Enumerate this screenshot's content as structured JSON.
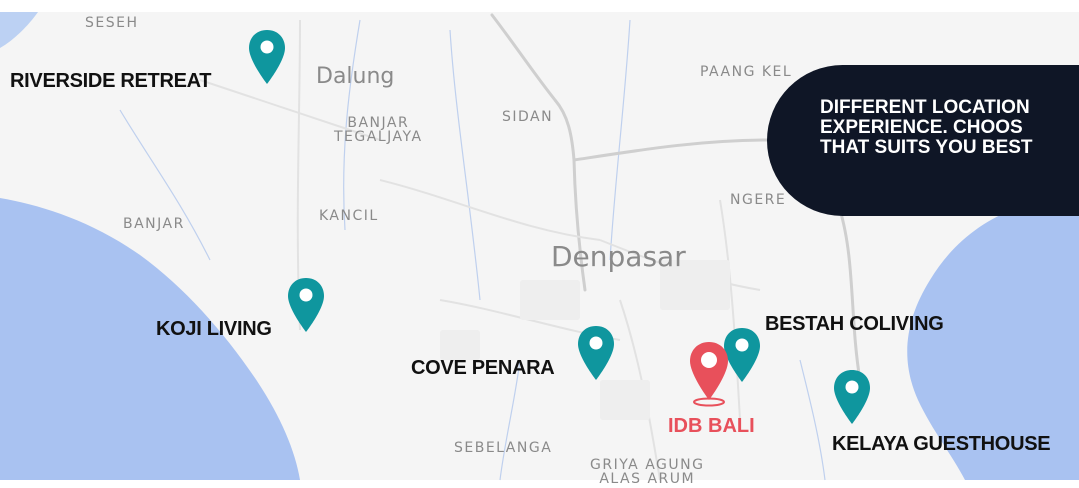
{
  "map": {
    "water_color": "#a9c2f1",
    "land_color": "#f6f6f6",
    "road_color": "#d3d3d3",
    "area_labels": {
      "seseh": "SESEH",
      "banjar_tegaljaya": "BANJAR\nTEGALJAYA",
      "sidan": "SIDAN",
      "paang_kelod": "PAANG KEL",
      "ngereh": "NGERE",
      "kancil": "KANCIL",
      "banjar": "BANJAR",
      "sebelanga": "SEBELANGA",
      "griya_agung": "GRIYA AGUNG\nALAS ARUM"
    },
    "city_labels": {
      "dalung": "Dalung",
      "denpasar": "Denpasar"
    }
  },
  "locations": {
    "riverside": {
      "label": "RIVERSIDE RETREAT",
      "icon": "map-pin-icon"
    },
    "koji": {
      "label": "KOJI LIVING",
      "icon": "map-pin-icon"
    },
    "cove": {
      "label": "COVE PENARA",
      "icon": "map-pin-icon"
    },
    "bestah": {
      "label": "BESTAH COLIVING",
      "icon": "map-pin-icon"
    },
    "kelaya": {
      "label": "KELAYA GUESTHOUSE",
      "icon": "map-pin-icon"
    },
    "idb": {
      "label": "IDB BALI",
      "icon": "map-pin-icon"
    }
  },
  "pin_colors": {
    "teal": "#0f969e",
    "red": "#e8505b"
  },
  "callout": {
    "text": "DIFFERENT LOCATION\nEXPERIENCE. CHOOS\nTHAT SUITS YOU BEST",
    "background": "#0f1626"
  }
}
